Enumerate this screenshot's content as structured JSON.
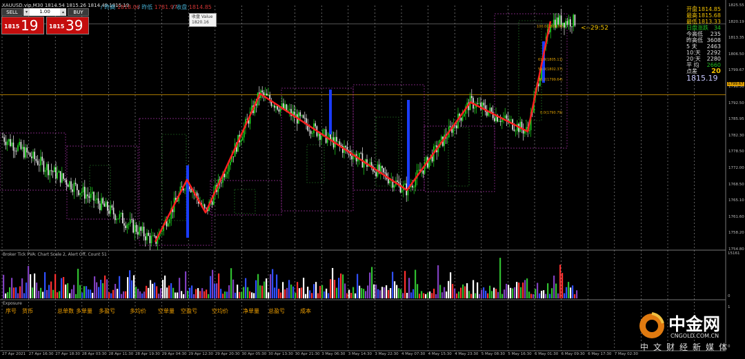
{
  "window": {
    "symbol_title": "XAUUSD.vip,M30",
    "ohlc_values": [
      "1814.54",
      "1815.26",
      "1814.49",
      "1815.19"
    ],
    "stats_open_label": "/ 昨高",
    "stats_open_value": "1818.06",
    "stats_low_label": "/ 昨低",
    "stats_low_value": "1781.97",
    "stats_close_label": "/ 收盘",
    "stats_close_value": "1814.85"
  },
  "trade_panel": {
    "sell_label": "SELL",
    "buy_label": "BUY",
    "lot_value": "1.00",
    "bid_small": "1815",
    "bid_big": "19",
    "ask_small": "1815",
    "ask_big": "39"
  },
  "tooltip": {
    "label": "收盘 Value",
    "value": "1820.16"
  },
  "countdown": "<--29:52",
  "right_stats": [
    {
      "label": "开盘",
      "value": "1814.85",
      "color": "#f0c000"
    },
    {
      "label": "最高",
      "value": "1815.68",
      "color": "#f0c000"
    },
    {
      "label": "最低",
      "value": "1813.33",
      "color": "#f0c000"
    },
    {
      "label": "日盘涨跌",
      "value": "34",
      "color": "#20c020"
    },
    {
      "label": "今高低",
      "value": "235",
      "color": "#e0e0e0"
    },
    {
      "label": "昨高低",
      "value": "3608",
      "color": "#e0e0e0"
    },
    {
      "label": "5 天",
      "value": "2463",
      "color": "#e0e0e0"
    },
    {
      "label": "10 天",
      "value": "2292",
      "color": "#e0e0e0"
    },
    {
      "label": "20 天",
      "value": "2280",
      "color": "#e0e0e0"
    },
    {
      "label": "平 均",
      "value": "2660",
      "color": "#20c020"
    },
    {
      "label": "点差",
      "value": "20",
      "color": "#f0c000"
    }
  ],
  "current_price": "1815.19",
  "price_axis": [
    "1825.55",
    "1820.19",
    "1813.35",
    "1806.50",
    "1799.67",
    "1796.50",
    "1792.50",
    "1785.95",
    "1782.30",
    "1778.50",
    "1772.00",
    "1768.50",
    "1765.10",
    "1761.60",
    "1758.20",
    "1754.80"
  ],
  "price_line_label": "1799.67",
  "fib_labels": [
    "100.0(1818.06)",
    "61.8(1805.11)",
    "50.0(1802.37)",
    "38.2(1799.64)",
    "0.0(1790.79)"
  ],
  "volume_panel": {
    "label": "Broker Tick PVA:  Chart Scale 2, Alert Off, Count 51",
    "max": "15161",
    "zero": "0"
  },
  "exposure_panel": {
    "label": "Exposure",
    "headers": [
      "序号",
      "货币",
      "总单数",
      "多单量",
      "多盈亏",
      "多均价",
      "空单量",
      "空盈亏",
      "空均价",
      "净单量",
      "总盈亏",
      "成本"
    ],
    "axis_top": "1",
    "axis_bottom": "0"
  },
  "time_axis": [
    "27 Apr 2021",
    "27 Apr 16:30",
    "27 Apr 18:30",
    "28 Apr 03:30",
    "28 Apr 11:30",
    "28 Apr 19:30",
    "29 Apr 04:30",
    "29 Apr 12:30",
    "29 Apr 20:30",
    "30 Apr 05:30",
    "30 Apr 13:30",
    "30 Apr 21:30",
    "3 May 06:30",
    "3 May 14:30",
    "3 May 22:30",
    "4 May 07:30",
    "4 May 15:30",
    "4 May 23:30",
    "5 May 08:30",
    "5 May 16:30",
    "6 May 01:30",
    "6 May 09:30",
    "6 May 17:30",
    "7 May 02:30"
  ],
  "logo": {
    "name": "中金网",
    "domain": "CNGOLD.COM.CN",
    "slogan": "中文财经新媒体"
  },
  "chart_data": {
    "type": "line",
    "title": "",
    "xlabel": "",
    "ylabel": "",
    "ylim": [
      1754.8,
      1825.55
    ],
    "series": [
      {
        "values": [
          1787.5,
          1757.0,
          1775.0,
          1765.5,
          1800.0,
          1772.0,
          1797.5,
          1789.0,
          1821.0
        ]
      }
    ],
    "colors": {
      "up_candle": "#20e020",
      "down_candle": "#f0f0f0",
      "zigzag": "#ff2020",
      "grid": "#a0a0a0",
      "box": "#a030a0"
    }
  }
}
